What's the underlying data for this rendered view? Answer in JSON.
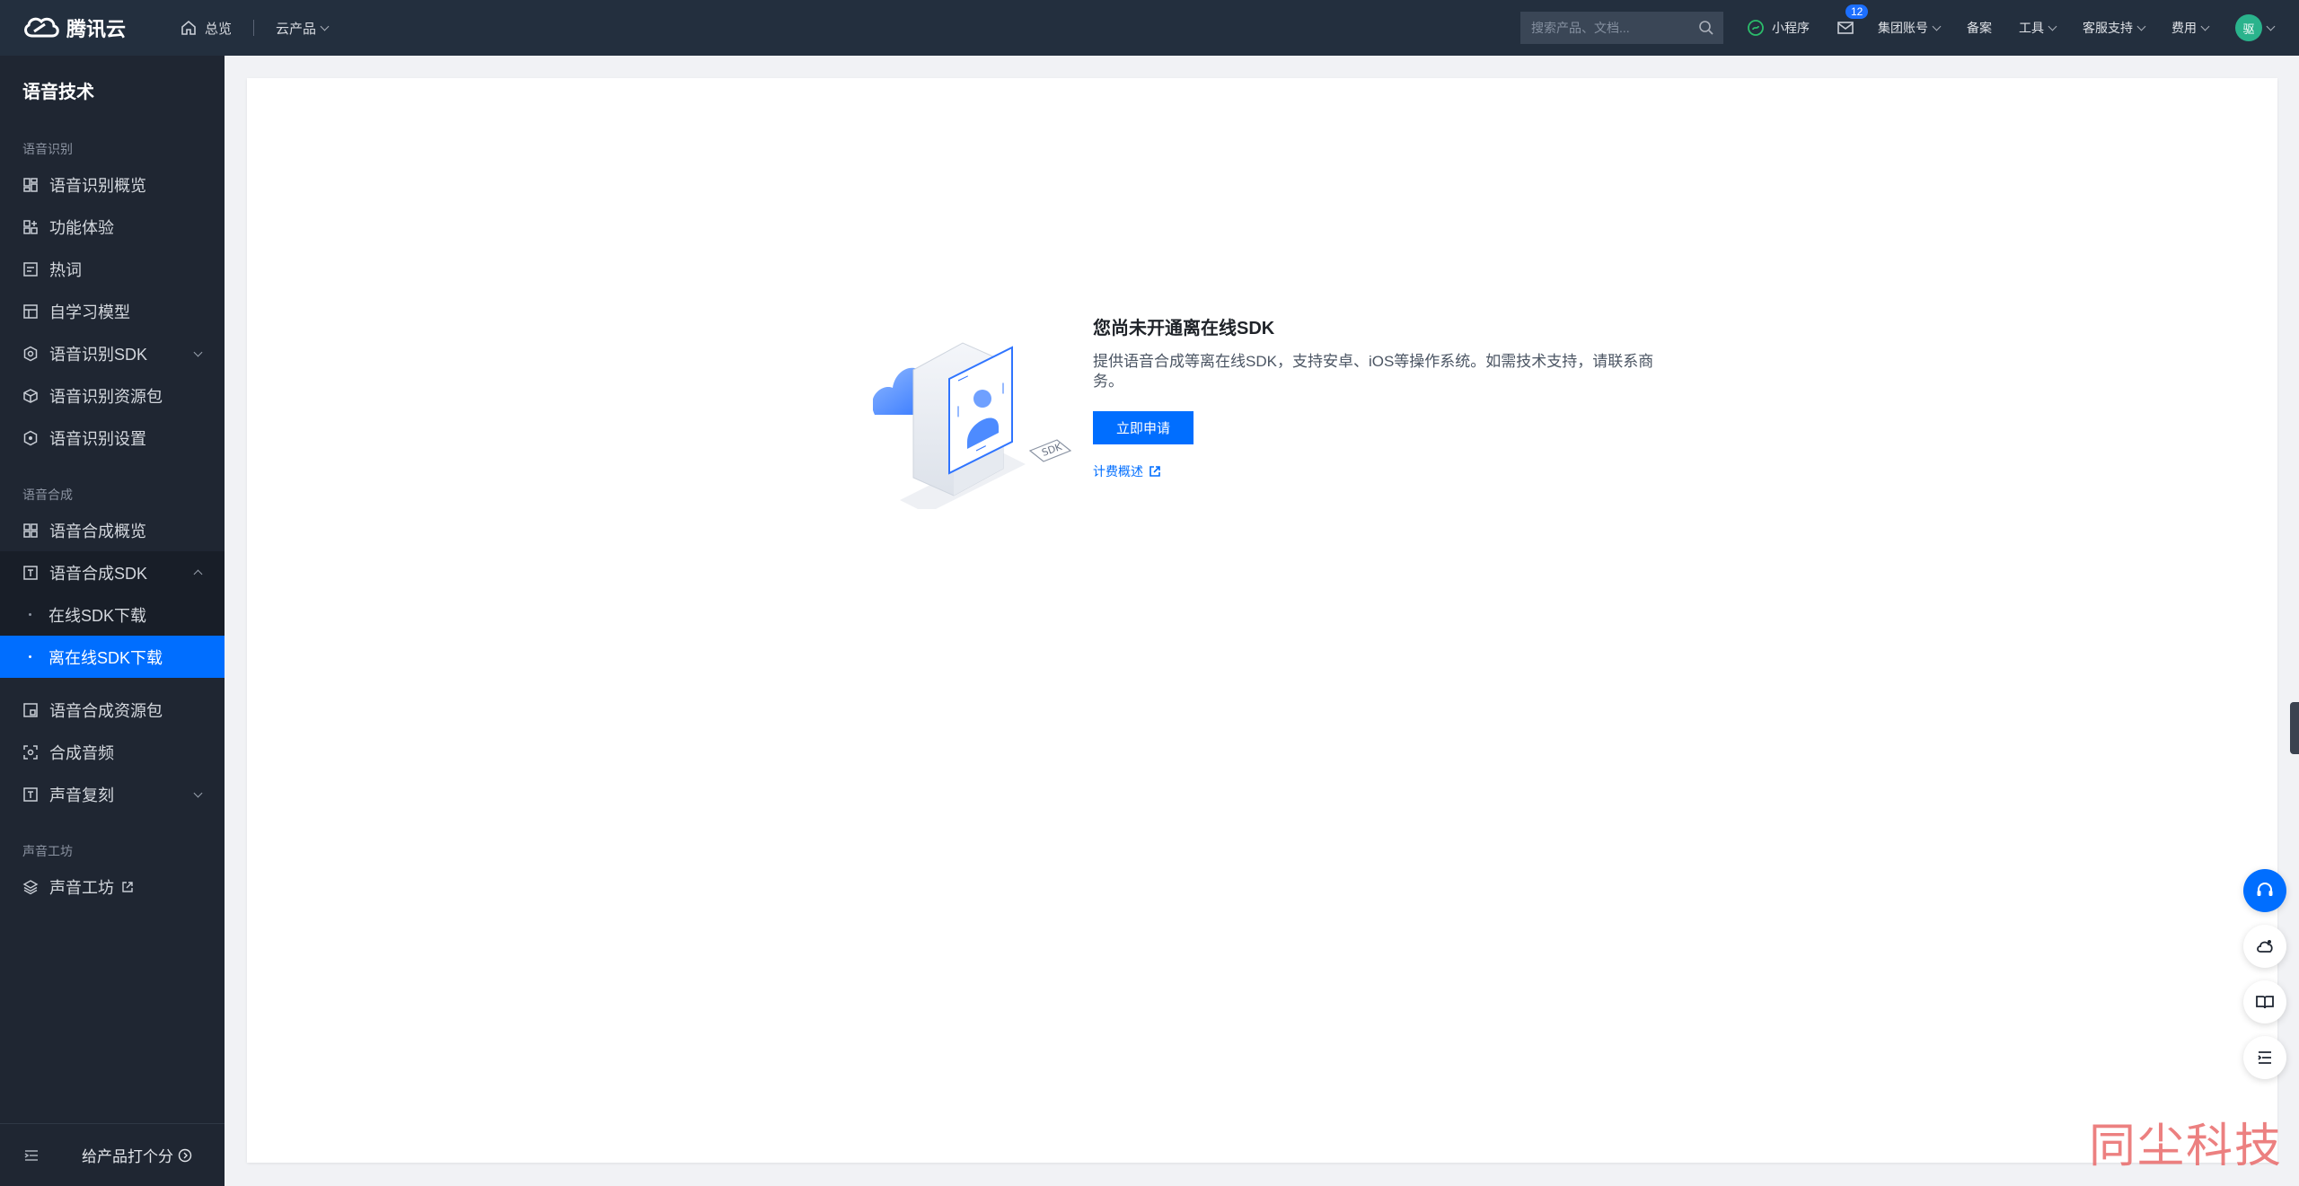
{
  "header": {
    "brand": "腾讯云",
    "home": "总览",
    "products": "云产品",
    "search_placeholder": "搜索产品、文档...",
    "mini_program": "小程序",
    "message_count": "12",
    "group_account": "集团账号",
    "filing": "备案",
    "tools": "工具",
    "support": "客服支持",
    "billing": "费用",
    "avatar_text": "驱"
  },
  "sidebar": {
    "title": "语音技术",
    "groups": {
      "asr": "语音识别",
      "tts": "语音合成",
      "studio": "声音工坊"
    },
    "asr_items": [
      "语音识别概览",
      "功能体验",
      "热词",
      "自学习模型",
      "语音识别SDK",
      "语音识别资源包",
      "语音识别设置"
    ],
    "tts_items": [
      "语音合成概览",
      "语音合成SDK"
    ],
    "tts_sub": [
      "在线SDK下载",
      "离在线SDK下载"
    ],
    "tts_items2": [
      "语音合成资源包",
      "合成音频",
      "声音复刻"
    ],
    "studio_items": [
      "声音工坊"
    ],
    "footer_rate": "给产品打个分"
  },
  "main": {
    "title": "您尚未开通离在线SDK",
    "desc": "提供语音合成等离在线SDK，支持安卓、iOS等操作系统。如需技术支持，请联系商务。",
    "apply_button": "立即申请",
    "billing_link": "计费概述",
    "illustration_badge": "SDK"
  },
  "watermark": "同尘科技",
  "colors": {
    "topbar": "#232f3e",
    "sidebar": "#1f2632",
    "accent": "#006eff",
    "page_bg": "#f1f2f5"
  }
}
